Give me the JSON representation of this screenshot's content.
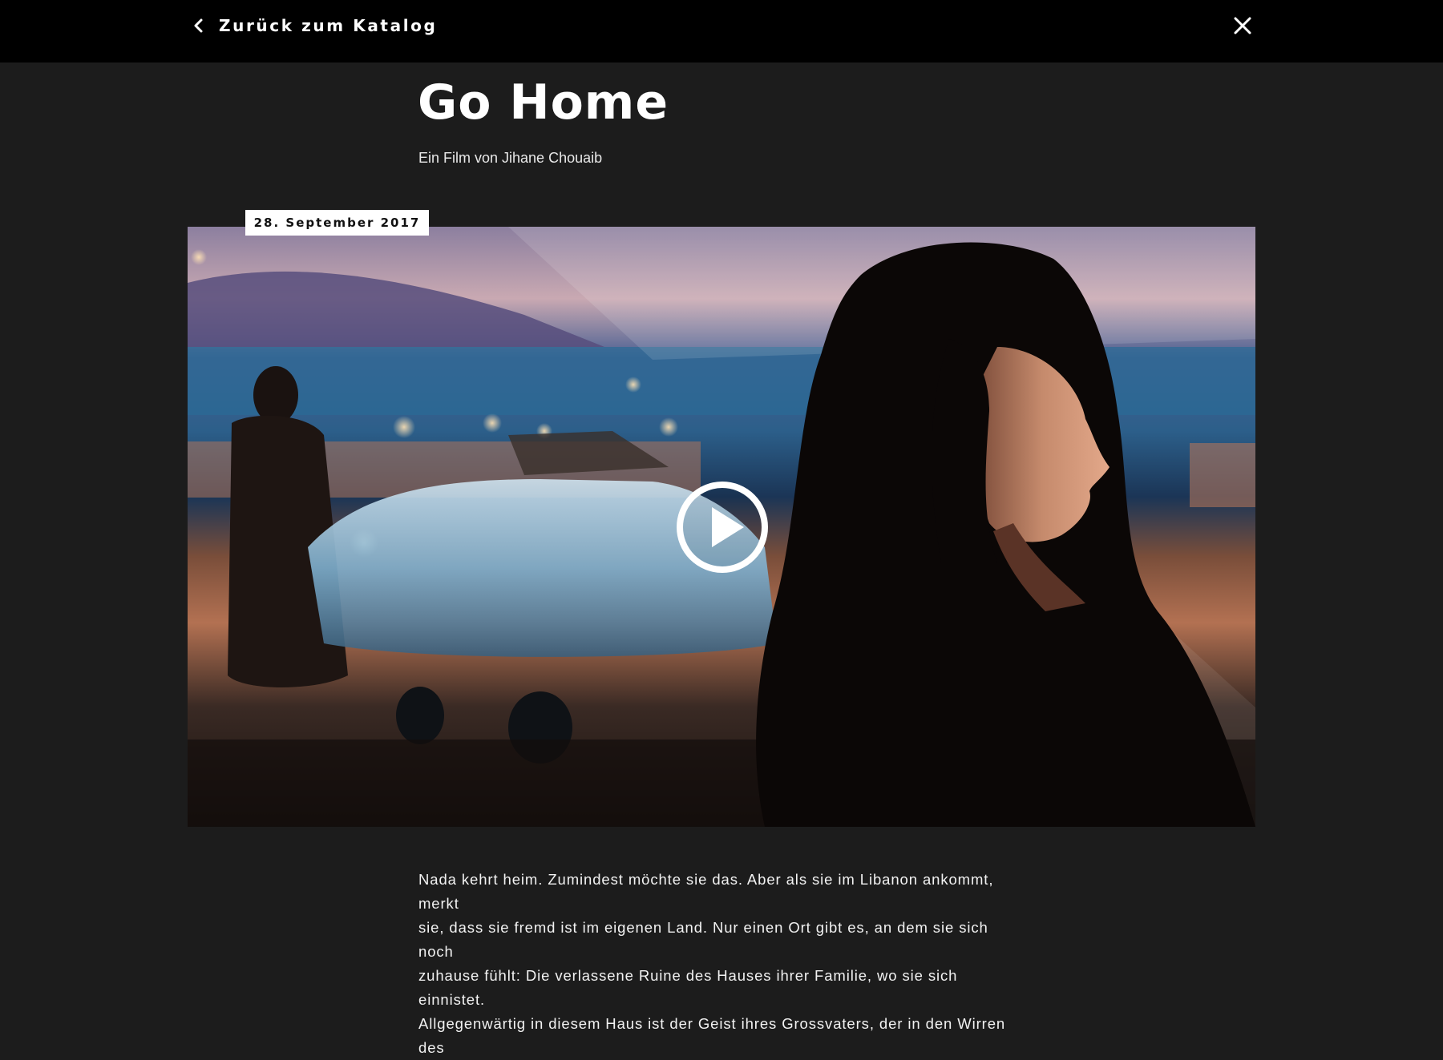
{
  "header": {
    "back_label": "Zurück zum Katalog",
    "back_icon": "chevron-left-icon",
    "close_icon": "close-icon"
  },
  "film": {
    "title": "Go Home",
    "subtitle": "Ein Film von Jihane Chouaib",
    "date": "28. September 2017",
    "play_icon": "play-icon"
  },
  "description": {
    "lines": [
      "Nada kehrt heim. Zumindest möchte sie das. Aber als sie im Libanon ankommt, merkt",
      "sie, dass sie fremd ist im eigenen Land. Nur einen Ort gibt es, an dem sie sich noch",
      "zuhause fühlt: Die verlassene Ruine des Hauses ihrer Familie, wo sie sich einnistet.",
      "Allgegenwärtig in diesem Haus ist der Geist ihres Grossvaters, der in den Wirren des"
    ]
  },
  "colors": {
    "page_background": "#1c1c1c",
    "header_background": "#000000",
    "text": "#ffffff",
    "badge_background": "#ffffff"
  }
}
